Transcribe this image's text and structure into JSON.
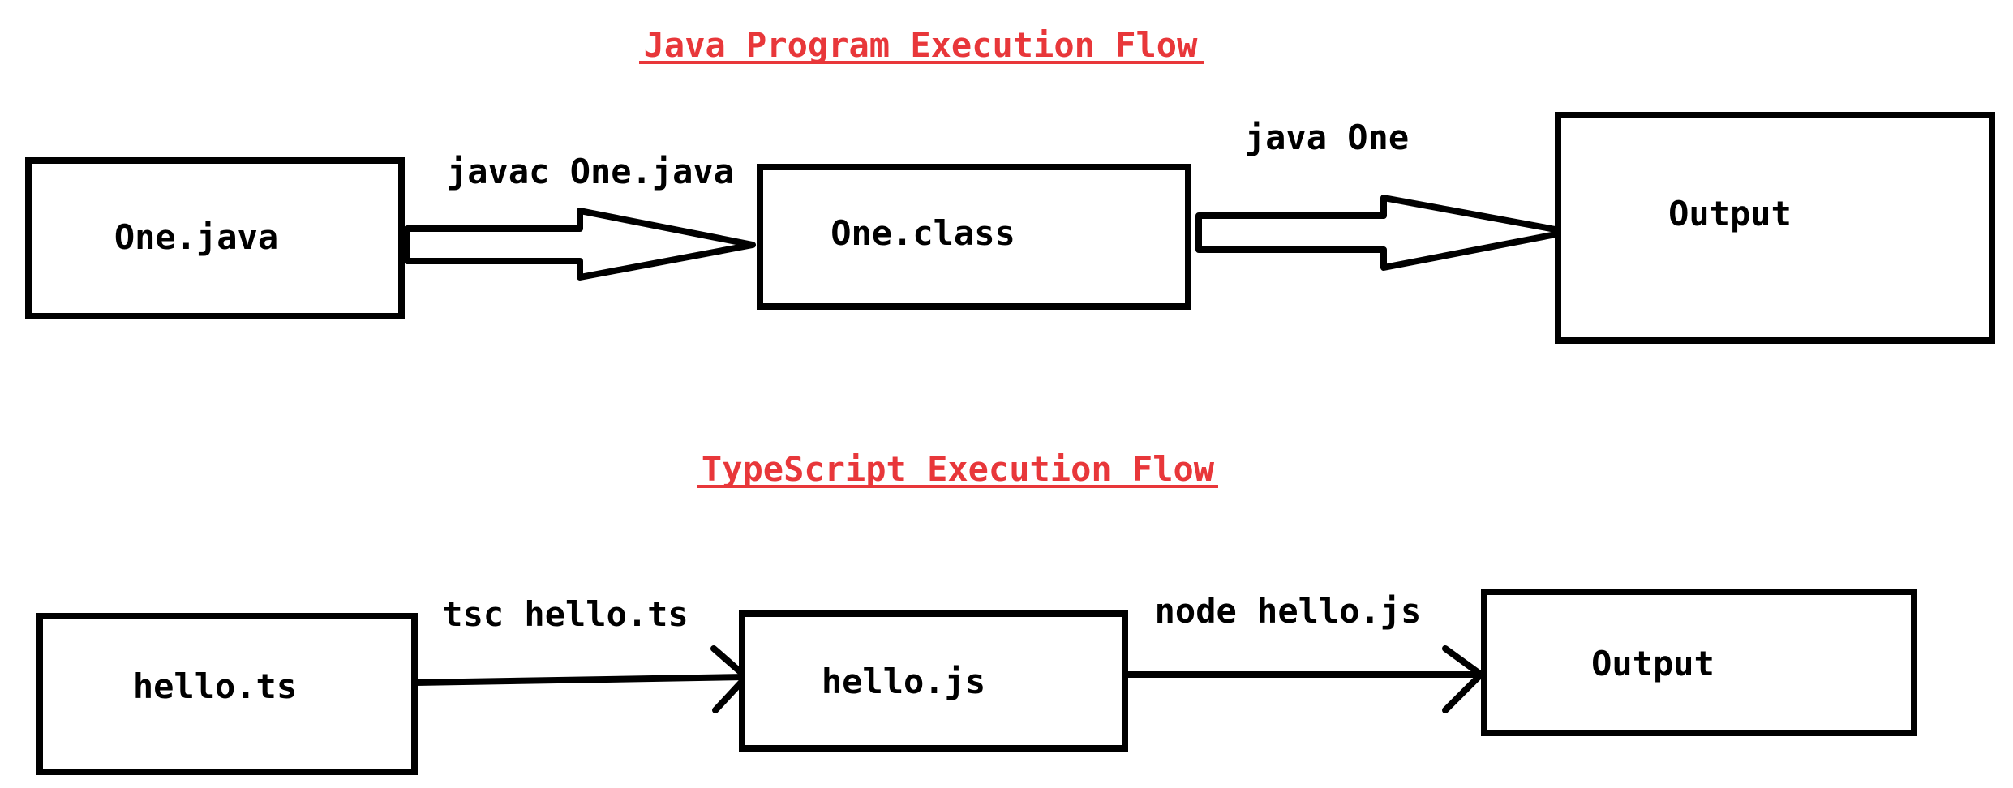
{
  "colors": {
    "title": "#e8373a",
    "stroke": "#000000",
    "background": "#ffffff"
  },
  "java_flow": {
    "title": "Java Program Execution Flow",
    "nodes": [
      "One.java",
      "One.class",
      "Output"
    ],
    "edges": [
      "javac One.java",
      "java One"
    ]
  },
  "ts_flow": {
    "title": "TypeScript Execution Flow",
    "nodes": [
      "hello.ts",
      "hello.js",
      "Output"
    ],
    "edges": [
      "tsc hello.ts",
      "node hello.js"
    ]
  }
}
